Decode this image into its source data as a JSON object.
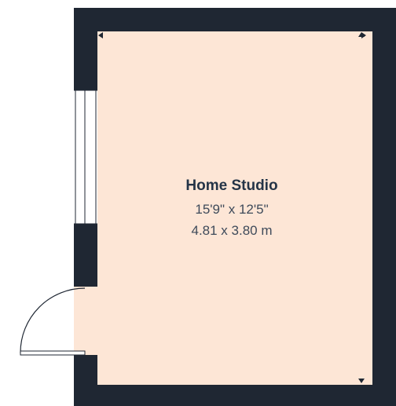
{
  "room": {
    "name": "Home Studio",
    "dimensions_imperial": "15'9\" x 12'5\"",
    "dimensions_metric": "4.81 x 3.80 m"
  },
  "colors": {
    "wall": "#1f2733",
    "floor": "#fde6d6",
    "window_frame": "#1f2733",
    "window_glass": "#ffffff",
    "door_line": "#1f2733"
  },
  "elements": {
    "window": "window",
    "door": "door-swing",
    "dimension_markers": "measurement-arrows"
  }
}
